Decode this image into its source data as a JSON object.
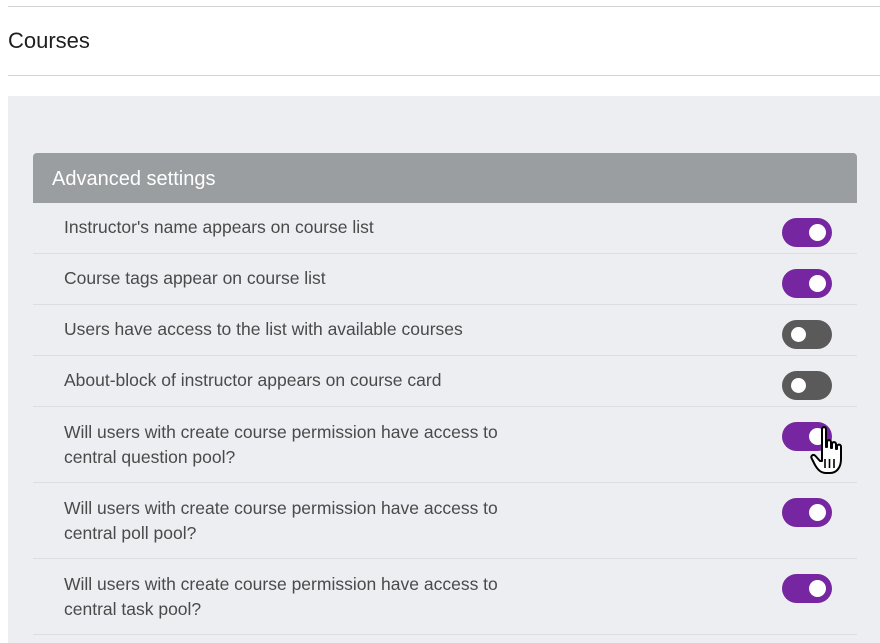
{
  "page": {
    "title": "Courses"
  },
  "panel": {
    "header": "Advanced settings",
    "settings": [
      {
        "label": "Instructor's name appears on course list",
        "enabled": true
      },
      {
        "label": "Course tags appear on course list",
        "enabled": true
      },
      {
        "label": "Users have access to the list with available courses",
        "enabled": false
      },
      {
        "label": "About-block of instructor appears on course card",
        "enabled": false
      },
      {
        "label": "Will users with create course permission have access to central question pool?",
        "enabled": true
      },
      {
        "label": "Will users with create course permission have access to central poll pool?",
        "enabled": true
      },
      {
        "label": "Will users with create course permission have access to central task pool?",
        "enabled": true
      }
    ]
  },
  "colors": {
    "toggle_on": "#7526a0",
    "toggle_off": "#5a5a5a",
    "header_bg": "#9b9ea1",
    "content_bg": "#edeef2"
  },
  "icons": {
    "cursor": "hand-pointer-icon"
  }
}
